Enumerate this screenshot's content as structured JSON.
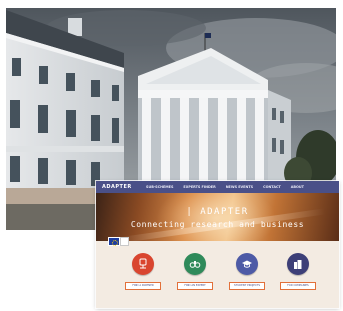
{
  "website": {
    "logo": "ADAPTER",
    "nav": [
      "SUB-SCHEMES",
      "EXPERTS FINDER",
      "NEWS EVENTS",
      "CONTACT",
      "ABOUT"
    ],
    "hero": {
      "title": "ADAPTER",
      "subtitle": "Connecting research and business"
    },
    "cards": [
      {
        "icon": "research-icon",
        "color": "#d9452f",
        "button": "FIND A PARTNER"
      },
      {
        "icon": "binoculars-icon",
        "color": "#2f8a5a",
        "button": "FIND AN EXPERT"
      },
      {
        "icon": "graduation-cap-icon",
        "color": "#4d5aa6",
        "button": "STUDENT PROJECTS"
      },
      {
        "icon": "buildings-icon",
        "color": "#3d3f78",
        "button": "FOR COMPANIES"
      }
    ]
  },
  "colors": {
    "nav_bar": "#4a5088",
    "button_border": "#e2703a",
    "page_background": "#f3ebe2"
  }
}
